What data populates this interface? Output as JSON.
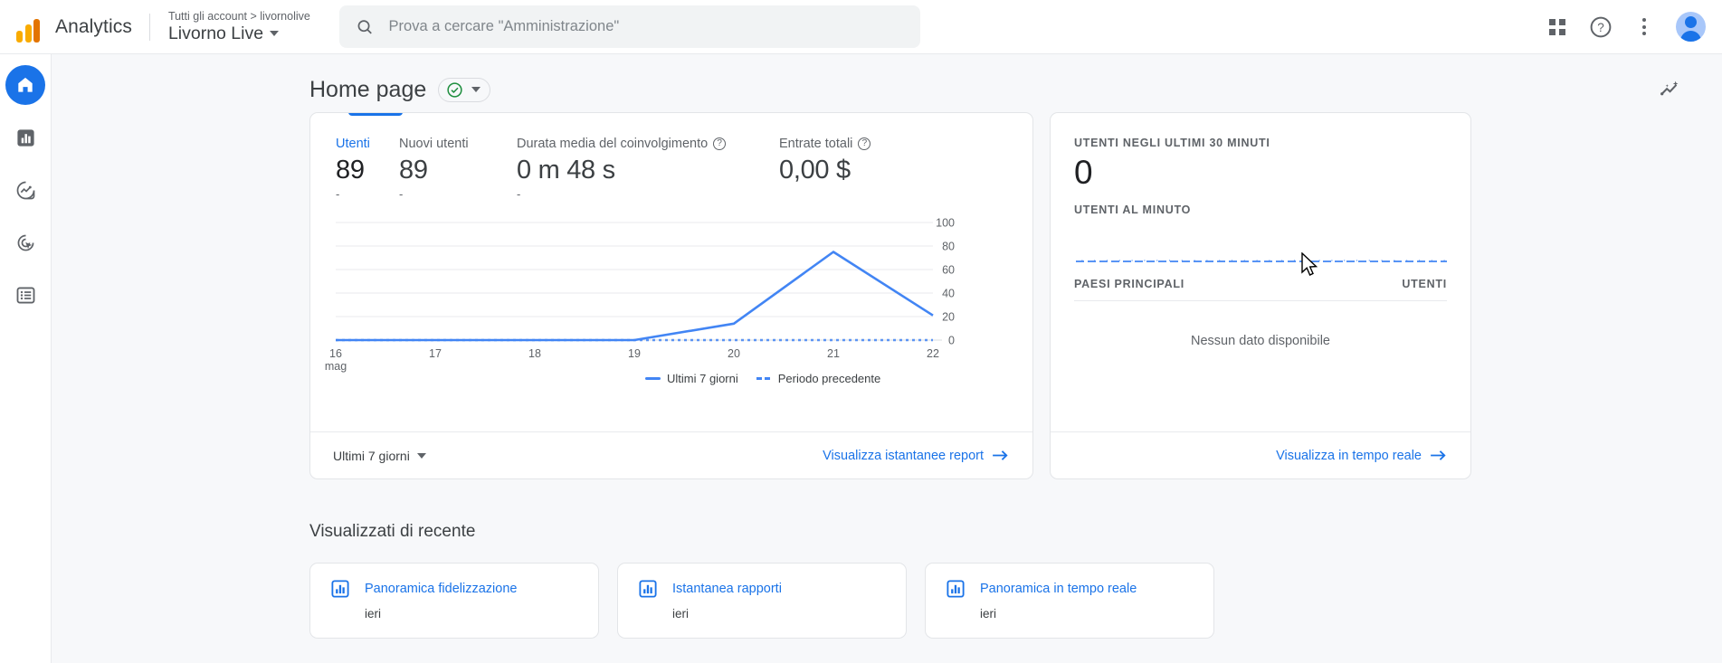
{
  "topbar": {
    "brand": "Analytics",
    "breadcrumb": "Tutti gli account > livornolive",
    "property": "Livorno Live",
    "search_placeholder": "Prova a cercare \"Amministrazione\"",
    "search_value": "",
    "icons": [
      "apps-grid-icon",
      "help-icon",
      "more-options-icon",
      "avatar"
    ]
  },
  "sidebar": {
    "items": [
      {
        "name": "home",
        "label": "Home",
        "icon": "home-icon",
        "active": true
      },
      {
        "name": "reports",
        "label": "Report",
        "icon": "bar-chart-icon",
        "active": false
      },
      {
        "name": "explore",
        "label": "Esplora",
        "icon": "explore-trending-icon",
        "active": false
      },
      {
        "name": "advertising",
        "label": "Pubblicità",
        "icon": "advertising-target-icon",
        "active": false
      },
      {
        "name": "configure",
        "label": "Configura",
        "icon": "list-icon",
        "active": false
      }
    ]
  },
  "page": {
    "title": "Home page",
    "status_icon": "check-circle-icon",
    "status_color": "#1e8e3e",
    "insights_icon": "insights-sparkle-icon"
  },
  "overview": {
    "metrics": [
      {
        "label": "Utenti",
        "value": "89",
        "delta": "-",
        "selected": true,
        "has_help": false
      },
      {
        "label": "Nuovi utenti",
        "value": "89",
        "delta": "-",
        "selected": false,
        "has_help": false
      },
      {
        "label": "Durata media del coinvolgimento",
        "value": "0 m 48 s",
        "delta": "-",
        "selected": false,
        "has_help": true
      },
      {
        "label": "Entrate totali",
        "value": "0,00 $",
        "delta": "",
        "selected": false,
        "has_help": true
      }
    ],
    "legend": [
      {
        "label": "Ultimi 7 giorni",
        "style": "solid",
        "color": "#4285f4"
      },
      {
        "label": "Periodo precedente",
        "style": "dashed",
        "color": "#4285f4"
      }
    ],
    "footer": {
      "range_label": "Ultimi 7 giorni",
      "link_label": "Visualizza istantanee report",
      "link_icon": "arrow-right-icon"
    }
  },
  "chart_data": {
    "type": "line",
    "title": "Utenti",
    "xlabel": "",
    "ylabel": "",
    "x": [
      "16",
      "17",
      "18",
      "19",
      "20",
      "21",
      "22"
    ],
    "x_sub": "mag",
    "ylim": [
      0,
      100
    ],
    "yticks": [
      0,
      20,
      40,
      60,
      80,
      100
    ],
    "grid": true,
    "legend_position": "bottom-left",
    "series": [
      {
        "name": "Ultimi 7 giorni",
        "style": "solid",
        "color": "#4285f4",
        "values": [
          0,
          0,
          0,
          0,
          14,
          75,
          21
        ]
      },
      {
        "name": "Periodo precedente",
        "style": "dashed",
        "color": "#4285f4",
        "values": [
          0,
          0,
          0,
          0,
          0,
          0,
          0
        ]
      }
    ]
  },
  "realtime": {
    "caption_users_30min": "UTENTI NEGLI ULTIMI 30 MINUTI",
    "users_30min": "0",
    "caption_users_per_minute": "UTENTI AL MINUTO",
    "sparkline_values": [
      0,
      0,
      0,
      0,
      0,
      0,
      0,
      0,
      0,
      0,
      0,
      0,
      0,
      0,
      0,
      0,
      0,
      0,
      0,
      0,
      0,
      0,
      0,
      0,
      0,
      0,
      0,
      0,
      0,
      0
    ],
    "table_head_left": "PAESI PRINCIPALI",
    "table_head_right": "UTENTI",
    "empty_text": "Nessun dato disponibile",
    "footer": {
      "link_label": "Visualizza in tempo reale",
      "link_icon": "arrow-right-icon"
    }
  },
  "recent": {
    "title": "Visualizzati di recente",
    "cards": [
      {
        "icon": "report-bar-icon",
        "name": "Panoramica fidelizzazione",
        "sub": "ieri"
      },
      {
        "icon": "report-bar-icon",
        "name": "Istantanea rapporti",
        "sub": "ieri"
      },
      {
        "icon": "report-bar-icon",
        "name": "Panoramica in tempo reale",
        "sub": "ieri"
      }
    ]
  },
  "colors": {
    "accent": "#1a73e8",
    "chart_line": "#4285f4",
    "ok": "#1e8e3e",
    "bg": "#f7f8fa"
  }
}
